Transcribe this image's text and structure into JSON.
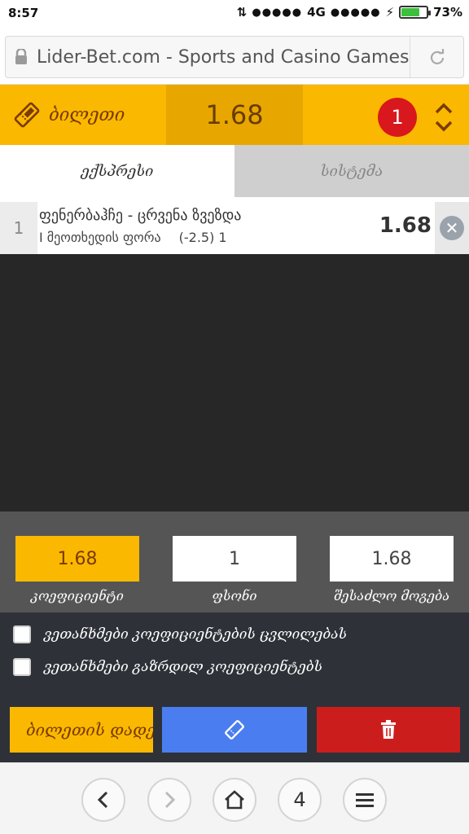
{
  "status_bar": {
    "time": "8:57",
    "network": "4G",
    "battery_percent": "73%",
    "battery_level": 0.73
  },
  "browser": {
    "url_display": "Lider-Bet.com - Sports and Casino Games"
  },
  "ticket_header": {
    "title": "ბილეთი",
    "total_odds": "1.68",
    "selection_count": "1"
  },
  "tabs": [
    {
      "label": "ექსპრესი",
      "active": true
    },
    {
      "label": "სისტემა",
      "active": false
    }
  ],
  "bet": {
    "index": "1",
    "match": "ფენერბაჰჩე - ცრვენა ზვეზდა",
    "market": "I მეოთხედის ფორა",
    "handicap": "(-2.5) 1",
    "odd": "1.68"
  },
  "stats": {
    "coefficient": {
      "value": "1.68",
      "label": "კოეფიციენტი"
    },
    "stake": {
      "value": "1",
      "label": "ფსონი"
    },
    "possible_win": {
      "value": "1.68",
      "label": "შესაძლო მოგება"
    }
  },
  "agreements": [
    "ვეთანხმები კოეფიციენტების ცვლილებას",
    "ვეთანხმები გაზრდილ კოეფიციენტებს"
  ],
  "actions": {
    "place_label": "ბილეთის დადება"
  },
  "nav": {
    "tabs_count": "4"
  },
  "colors": {
    "brand_yellow": "#fbb800",
    "accent_blue": "#4a7ef0",
    "danger_red": "#cc1d1d"
  }
}
